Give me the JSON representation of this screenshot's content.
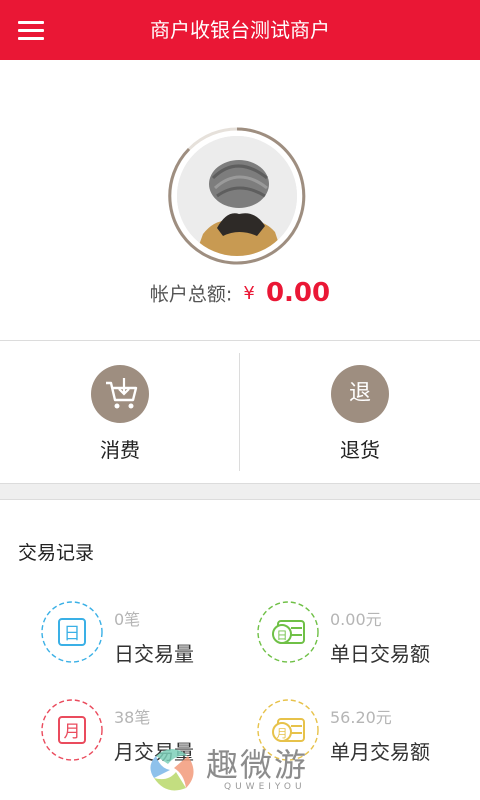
{
  "header": {
    "title": "商户收银台测试商户",
    "menu_icon": "menu-icon",
    "bg_color": "#ea1735"
  },
  "profile": {
    "balance_label": "帐户总额:",
    "currency_symbol": "¥",
    "balance_value": "0.00"
  },
  "actions": [
    {
      "label": "消费",
      "icon": "cart-icon"
    },
    {
      "label": "退货",
      "icon_text": "退",
      "icon": "refund-icon"
    }
  ],
  "records": {
    "title": "交易记录",
    "stats": [
      {
        "value": "0笔",
        "label": "日交易量",
        "icon_text": "日",
        "icon_color": "#3ab0e6",
        "icon": "day-count-icon"
      },
      {
        "value": "0.00元",
        "label": "单日交易额",
        "icon_text": "日",
        "icon_color": "#6fc046",
        "icon": "day-amount-icon"
      },
      {
        "value": "38笔",
        "label": "月交易量",
        "icon_text": "月",
        "icon_color": "#ea4b5d",
        "icon": "month-count-icon"
      },
      {
        "value": "56.20元",
        "label": "单月交易额",
        "icon_text": "月",
        "icon_color": "#e7c24a",
        "icon": "month-amount-icon"
      }
    ]
  },
  "watermark": {
    "text": "趣微游",
    "sub": "QUWEIYOU"
  },
  "colors": {
    "accent": "#ea1735",
    "action_icon_bg": "#9e8e80"
  }
}
